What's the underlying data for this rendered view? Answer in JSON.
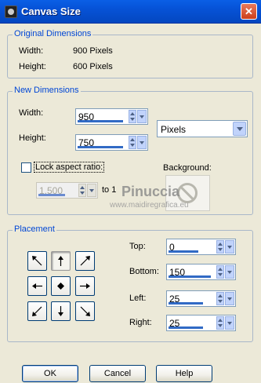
{
  "window": {
    "title": "Canvas Size",
    "close_label": "✕"
  },
  "original": {
    "legend": "Original Dimensions",
    "width_label": "Width:",
    "width_value": "900 Pixels",
    "height_label": "Height:",
    "height_value": "600 Pixels"
  },
  "new_dims": {
    "legend": "New Dimensions",
    "width_label": "Width:",
    "width_value": "950",
    "height_label": "Height:",
    "height_value": "750",
    "units": "Pixels",
    "lock_label": "Lock aspect ratio:",
    "ratio_value": "1,500",
    "ratio_suffix": "to 1",
    "background_label": "Background:"
  },
  "placement": {
    "legend": "Placement",
    "top_label": "Top:",
    "top_value": "0",
    "bottom_label": "Bottom:",
    "bottom_value": "150",
    "left_label": "Left:",
    "left_value": "25",
    "right_label": "Right:",
    "right_value": "25",
    "anchors": [
      "top-left",
      "top",
      "top-right",
      "left",
      "center",
      "right",
      "bottom-left",
      "bottom",
      "bottom-right"
    ],
    "selected_anchor": "top"
  },
  "buttons": {
    "ok": "OK",
    "cancel": "Cancel",
    "help": "Help"
  },
  "watermark": {
    "line1": "Pinuccia",
    "line2": "www.maidiregrafica.eu"
  },
  "colors": {
    "accent": "#316AC5",
    "legend": "#0046D5",
    "titlebar": "#0652D6"
  }
}
